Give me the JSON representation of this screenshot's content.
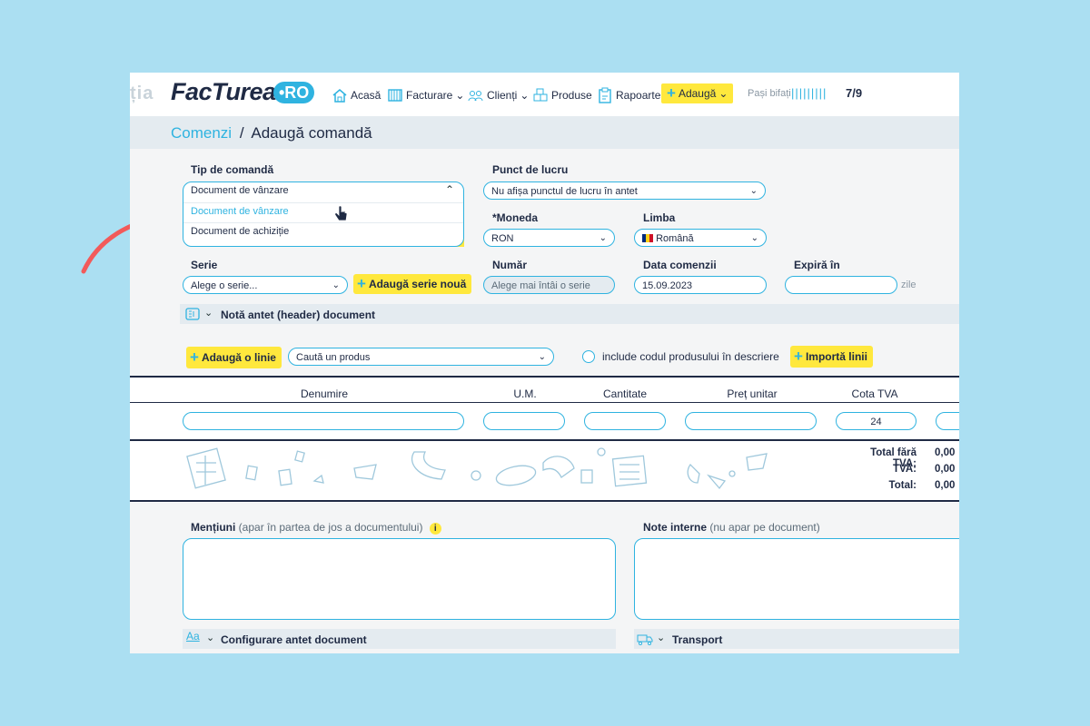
{
  "topbar": {
    "ghost_text": "ția",
    "logo_text": "FacTurează",
    "logo_suffix": "•RO",
    "nav": {
      "acasa": "Acasă",
      "facturare": "Facturare",
      "clienti": "Clienți",
      "produse": "Produse",
      "rapoarte": "Rapoarte",
      "adauga": "Adaugă"
    },
    "steps_label": "Pași bifați",
    "steps_bars": "|||||||||",
    "steps_count": "7/9"
  },
  "breadcrumb": {
    "parent": "Comenzi",
    "separator": "/",
    "current": "Adaugă comandă"
  },
  "form": {
    "tip_comanda": {
      "label": "Tip de comandă",
      "value": "Document de vânzare",
      "options": [
        "Document de vânzare",
        "Document de achiziție"
      ]
    },
    "punct_lucru": {
      "label": "Punct de lucru",
      "value": "Nu afișa punctul de lucru în antet"
    },
    "moneda": {
      "label": "*Moneda",
      "value": "RON"
    },
    "limba": {
      "label": "Limba",
      "value": "Română"
    },
    "serie": {
      "label": "Serie",
      "value": "Alege o serie...",
      "add_button": "Adaugă serie nouă"
    },
    "numar": {
      "label": "Număr",
      "value": "Alege mai întâi o serie"
    },
    "data_comenzii": {
      "label": "Data comenzii",
      "value": "15.09.2023"
    },
    "expira": {
      "label": "Expiră în",
      "unit": "zile",
      "value": ""
    }
  },
  "header_note": {
    "label": "Notă antet (header) document"
  },
  "lines_toolbar": {
    "add_line": "Adaugă o linie",
    "search_placeholder": "Caută un produs",
    "include_code": "include codul produsului în descriere",
    "import_lines": "Importă linii"
  },
  "table": {
    "columns": [
      "Denumire",
      "U.M.",
      "Cantitate",
      "Preț unitar",
      "Cota TVA"
    ],
    "row": {
      "cota_tva": "24"
    }
  },
  "totals": {
    "fara_tva_label": "Total fără TVA:",
    "fara_tva_value": "0,00",
    "tva_label": "TVA:",
    "tva_value": "0,00",
    "total_label": "Total:",
    "total_value": "0,00"
  },
  "mentiuni": {
    "label": "Mențiuni",
    "hint": "(apar în partea de jos a documentului)"
  },
  "note_interne": {
    "label": "Note interne",
    "hint": "(nu apar pe document)"
  },
  "bottom_sections": {
    "antet": "Configurare antet document",
    "transport": "Transport"
  },
  "colors": {
    "accent": "#2fb3e0",
    "yellow": "#ffe83d",
    "arrow": "#f25a5a",
    "background": "#abdff2"
  }
}
